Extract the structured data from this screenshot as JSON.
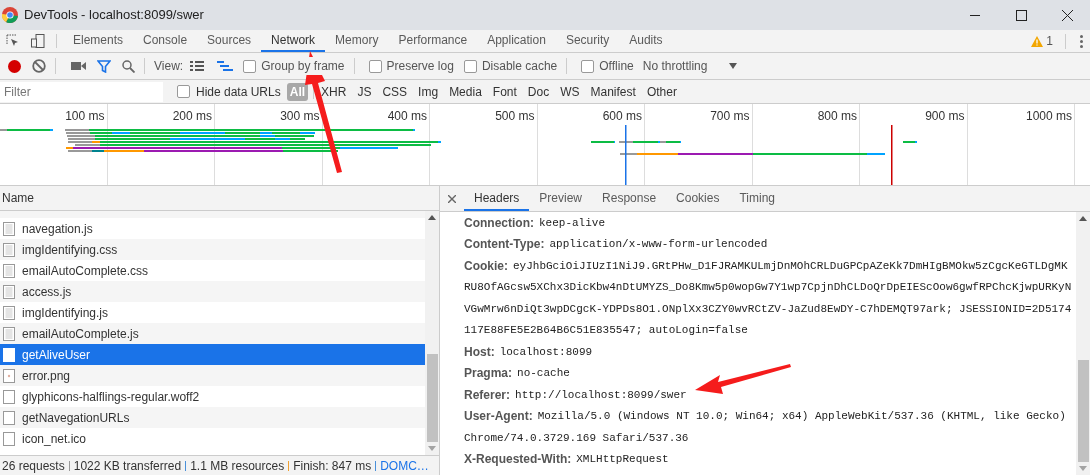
{
  "window": {
    "title": "DevTools - localhost:8099/swer"
  },
  "panel_tabs": [
    {
      "label": "Elements",
      "selected": false
    },
    {
      "label": "Console",
      "selected": false
    },
    {
      "label": "Sources",
      "selected": false
    },
    {
      "label": "Network",
      "selected": true
    },
    {
      "label": "Memory",
      "selected": false
    },
    {
      "label": "Performance",
      "selected": false
    },
    {
      "label": "Application",
      "selected": false
    },
    {
      "label": "Security",
      "selected": false
    },
    {
      "label": "Audits",
      "selected": false
    }
  ],
  "warnings": {
    "count": "1"
  },
  "toolbar": {
    "recording": true,
    "view_label": "View:",
    "checkboxes": [
      {
        "label": "Group by frame",
        "checked": false,
        "separator_before": false
      },
      {
        "label": "Preserve log",
        "checked": false,
        "separator_before": true
      },
      {
        "label": "Disable cache",
        "checked": false,
        "separator_before": false
      },
      {
        "label": "Offline",
        "checked": false,
        "separator_before": true
      }
    ],
    "throttling": "No throttling"
  },
  "filter_bar": {
    "placeholder": "Filter",
    "hide_data_urls": {
      "label": "Hide data URLs",
      "checked": false
    },
    "types": [
      {
        "label": "All",
        "selected": true
      },
      {
        "label": "XHR",
        "selected": false
      },
      {
        "label": "JS",
        "selected": false
      },
      {
        "label": "CSS",
        "selected": false
      },
      {
        "label": "Img",
        "selected": false
      },
      {
        "label": "Media",
        "selected": false
      },
      {
        "label": "Font",
        "selected": false
      },
      {
        "label": "Doc",
        "selected": false
      },
      {
        "label": "WS",
        "selected": false
      },
      {
        "label": "Manifest",
        "selected": false
      },
      {
        "label": "Other",
        "selected": false
      }
    ]
  },
  "timeline": {
    "ticks": [
      "100 ms",
      "200 ms",
      "300 ms",
      "400 ms",
      "500 ms",
      "600 ms",
      "700 ms",
      "800 ms",
      "900 ms",
      "1000 ms"
    ]
  },
  "requests": {
    "column": "Name",
    "rows": [
      {
        "name": "navegation.js",
        "kind": "script",
        "selected": false
      },
      {
        "name": "imgIdentifying.css",
        "kind": "script",
        "selected": false
      },
      {
        "name": "emailAutoComplete.css",
        "kind": "script",
        "selected": false
      },
      {
        "name": "access.js",
        "kind": "script",
        "selected": false
      },
      {
        "name": "imgIdentifying.js",
        "kind": "script",
        "selected": false
      },
      {
        "name": "emailAutoComplete.js",
        "kind": "script",
        "selected": false
      },
      {
        "name": "getAliveUser",
        "kind": "blank",
        "selected": true
      },
      {
        "name": "error.png",
        "kind": "image",
        "selected": false
      },
      {
        "name": "glyphicons-halflings-regular.woff2",
        "kind": "blank",
        "selected": false
      },
      {
        "name": "getNavegationURLs",
        "kind": "blank",
        "selected": false
      },
      {
        "name": "icon_net.ico",
        "kind": "blank",
        "selected": false
      }
    ]
  },
  "details": {
    "tabs": [
      {
        "label": "Headers",
        "selected": true
      },
      {
        "label": "Preview",
        "selected": false
      },
      {
        "label": "Response",
        "selected": false
      },
      {
        "label": "Cookies",
        "selected": false
      },
      {
        "label": "Timing",
        "selected": false
      }
    ],
    "headers": [
      {
        "key": "Connection:",
        "lines": [
          "keep-alive"
        ]
      },
      {
        "key": "Content-Type:",
        "lines": [
          "application/x-www-form-urlencoded"
        ]
      },
      {
        "key": "Cookie:",
        "lines": [
          "eyJhbGciOiJIUzI1NiJ9.GRtPHw_D1FJRAMKULmjDnMOhCRLDuGPCpAZeKk7DmHIgBMOkw5zCgcKeGTLDgMK",
          "RU8OfAGcsw5XChx3DicKbw4nDtUMYZS_Do8Kmw5p0wopGw7Y1wp7CpjnDhCLDoQrDpEIEScOow6gwfRPChcKjwpURKyN",
          "VGwMrw6nDiQt3wpDCgcK-YDPDs8O1.ONplXx3CZY0wvRCtZV-JaZud8EwDY-C7hDEMQT97ark; JSESSIONID=2D5174",
          "117E88FE5E2B64B6C51E835547; autoLogin=false"
        ]
      },
      {
        "key": "Host:",
        "lines": [
          "localhost:8099"
        ]
      },
      {
        "key": "Pragma:",
        "lines": [
          "no-cache"
        ]
      },
      {
        "key": "Referer:",
        "lines": [
          "http://localhost:8099/swer"
        ]
      },
      {
        "key": "User-Agent:",
        "lines": [
          "Mozilla/5.0 (Windows NT 10.0; Win64; x64) AppleWebKit/537.36 (KHTML, like Gecko)",
          "Chrome/74.0.3729.169 Safari/537.36"
        ]
      },
      {
        "key": "X-Requested-With:",
        "lines": [
          "XMLHttpRequest"
        ]
      }
    ]
  },
  "status_bar": {
    "items": [
      {
        "text": "26 requests",
        "kind": "plain"
      },
      {
        "text": "1022 KB transferred",
        "kind": "plain"
      },
      {
        "text": "1.1 MB resources",
        "kind": "plain"
      },
      {
        "text": "Finish: 847 ms",
        "kind": "plain"
      },
      {
        "text": "DOMC…",
        "kind": "link"
      }
    ]
  }
}
